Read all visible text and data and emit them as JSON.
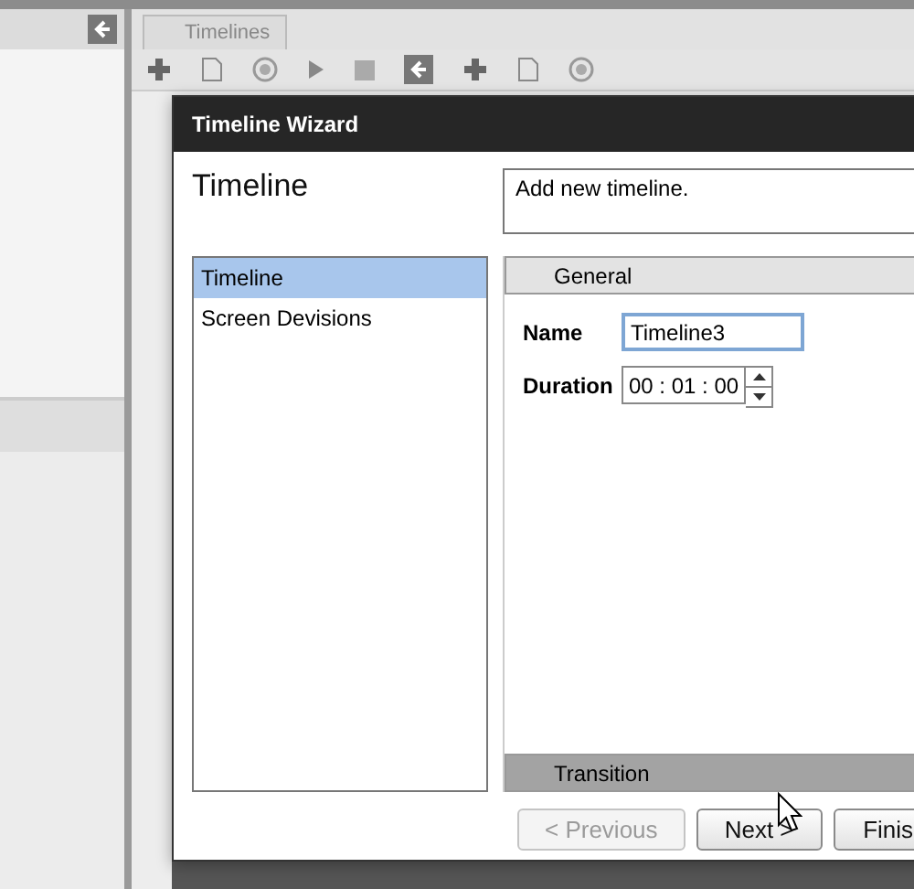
{
  "background": {
    "tab": "Timelines"
  },
  "window": {
    "title": "Timeline Wizard"
  },
  "heading": "Timeline",
  "description": "Add new timeline.",
  "steps": [
    {
      "label": "Timeline",
      "selected": true
    },
    {
      "label": "Screen Devisions",
      "selected": false
    }
  ],
  "sections": [
    {
      "title": "General",
      "kind": "open"
    },
    {
      "title": "Transition",
      "kind": "collapsed"
    }
  ],
  "fields": [
    {
      "label": "Name",
      "kind": "text",
      "value": "Timeline3",
      "focused": true
    },
    {
      "label": "Duration",
      "kind": "spin",
      "value": "00 : 01 : 00",
      "focused": false
    }
  ],
  "buttons": [
    {
      "label": "< Previous",
      "disabled": true
    },
    {
      "label": "Next >",
      "disabled": false
    },
    {
      "label": "Finis",
      "disabled": false
    }
  ]
}
